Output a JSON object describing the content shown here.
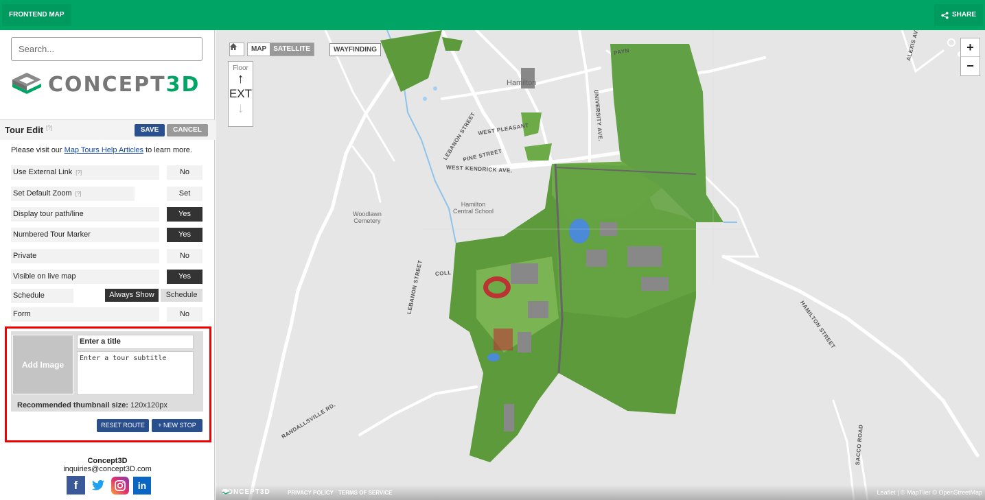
{
  "topbar": {
    "frontend_label": "FRONTEND MAP",
    "share_label": "SHARE"
  },
  "sidebar": {
    "search_placeholder": "Search...",
    "logo_text_main": "CONCEPT",
    "logo_text_accent": "3D",
    "tour_edit": {
      "title": "Tour Edit",
      "help": "[?]",
      "save_label": "SAVE",
      "cancel_label": "CANCEL",
      "intro_before": "Please visit our ",
      "intro_link": "Map Tours Help Articles",
      "intro_after": " to learn more."
    },
    "options": [
      {
        "label": "Use External Link",
        "help": "[?]",
        "value": "No",
        "on": false
      },
      {
        "label": "Set Default Zoom",
        "help": "[?]",
        "value": "Set",
        "on": false
      },
      {
        "label": "Display tour path/line",
        "help": "",
        "value": "Yes",
        "on": true
      },
      {
        "label": "Numbered Tour Marker",
        "help": "",
        "value": "Yes",
        "on": true
      },
      {
        "label": "Private",
        "help": "",
        "value": "No",
        "on": false
      },
      {
        "label": "Visible on live map",
        "help": "",
        "value": "Yes",
        "on": true
      }
    ],
    "schedule": {
      "label": "Schedule",
      "always_show": "Always Show",
      "schedule_btn": "Schedule"
    },
    "form": {
      "label": "Form",
      "value": "No"
    },
    "stop": {
      "add_image": "Add Image",
      "title_placeholder": "Enter a title",
      "subtitle_placeholder": "Enter a tour subtitle",
      "thumb_note_bold": "Recommended thumbnail size:",
      "thumb_note_value": " 120x120px",
      "reset_route": "RESET ROUTE",
      "new_stop": "+ NEW STOP"
    },
    "footer": {
      "name": "Concept3D",
      "email": "inquiries@concept3D.com"
    }
  },
  "map": {
    "toggle_map": "MAP",
    "toggle_satellite": "SATELLITE",
    "wayfinding": "WAYFINDING",
    "floor_label": "Floor",
    "floor_value": "EXT",
    "zoom_in": "+",
    "zoom_out": "−",
    "footer_logo": "CONCEPT3D",
    "privacy": "PRIVACY POLICY",
    "terms": "TERMS OF SERVICE",
    "attribution": "Leaflet | © MapTiler © OpenStreetMap",
    "labels": {
      "hamilton": "Hamilton",
      "woodlawn": "Woodlawn\nCemetery",
      "hcs": "Hamilton\nCentral School",
      "lebanon_st": "LEBANON STREET",
      "lebanon_st2": "LEBANON STREET",
      "west_pleasant": "WEST PLEASANT",
      "pine_st": "PINE STREET",
      "west_kendrick": "WEST KENDRICK AVE.",
      "university_ave": "UNIVERSITY AVE.",
      "hamilton_st": "HAMILTON STREET",
      "randallsville": "RANDALLSVILLE RD.",
      "sacco": "SACCO ROAD",
      "coll": "COLL",
      "payne": "PAYN",
      "alexis": "ALEXIS AVE"
    }
  }
}
